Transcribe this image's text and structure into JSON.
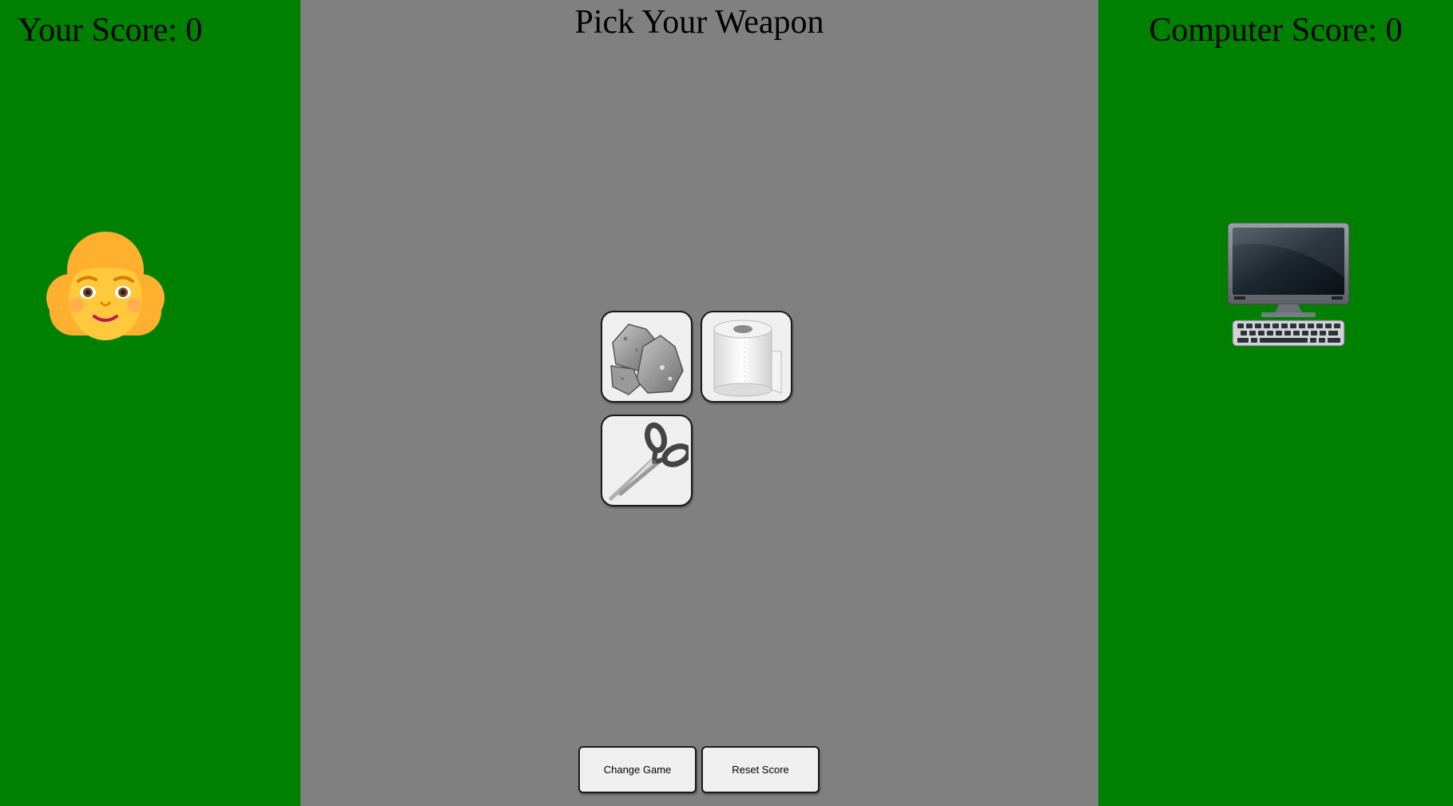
{
  "player": {
    "score_text": "Your Score: 0",
    "avatar_icon": "woman-face-icon"
  },
  "computer": {
    "score_text": "Computer Score: 0",
    "avatar_icon": "desktop-computer-icon"
  },
  "main": {
    "title": "Pick Your Weapon",
    "weapons": [
      {
        "id": "rock",
        "icon": "rock-icon"
      },
      {
        "id": "paper",
        "icon": "toilet-paper-roll-icon"
      },
      {
        "id": "scissors",
        "icon": "scissors-icon"
      }
    ]
  },
  "buttons": {
    "change_game": "Change Game",
    "reset_score": "Reset Score"
  },
  "colors": {
    "side_panel": "#008000",
    "center_panel": "#808080",
    "button_bg": "#efefef"
  }
}
